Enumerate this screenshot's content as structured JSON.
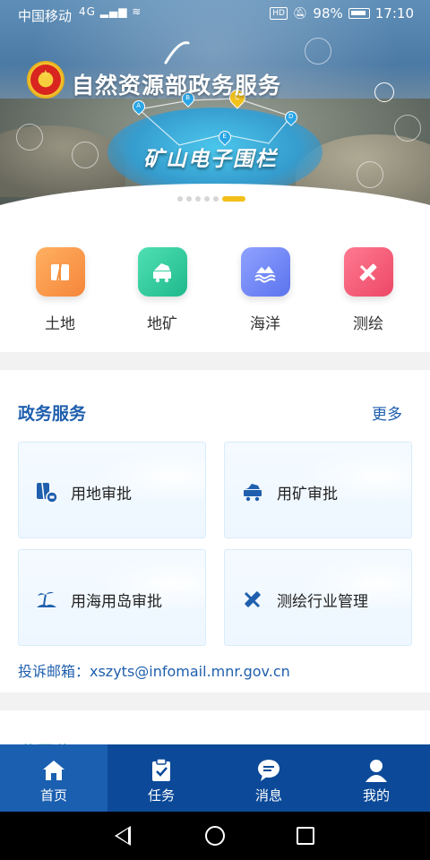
{
  "status_bar": {
    "carrier": "中国移动",
    "network": "4G",
    "hd": "HD",
    "battery": "98%",
    "time": "17:10"
  },
  "banner": {
    "title": "自然资源部政务服务",
    "subtitle": "矿山电子围栏",
    "pins": [
      "A",
      "B",
      "C",
      "D",
      "E"
    ],
    "carousel_total": 6,
    "carousel_active": 6
  },
  "categories": [
    {
      "label": "土地",
      "icon": "land-icon",
      "color": "#f5993d"
    },
    {
      "label": "地矿",
      "icon": "mining-cart-icon",
      "color": "#2dc79a"
    },
    {
      "label": "海洋",
      "icon": "ocean-wave-icon",
      "color": "#6f86f2"
    },
    {
      "label": "测绘",
      "icon": "surveying-ruler-icon",
      "color": "#f25573"
    }
  ],
  "services": {
    "title": "政务服务",
    "more": "更多",
    "cards": [
      {
        "label": "用地审批",
        "icon": "land-approval-icon"
      },
      {
        "label": "用矿审批",
        "icon": "mine-approval-icon"
      },
      {
        "label": "用海用岛审批",
        "icon": "island-approval-icon"
      },
      {
        "label": "测绘行业管理",
        "icon": "surveying-management-icon"
      }
    ],
    "email": "投诉邮箱：xszyts@infomail.mnr.gov.cn"
  },
  "public_section": {
    "title": "公开公示",
    "more": "更多"
  },
  "tabbar": [
    {
      "label": "首页",
      "icon": "home-icon",
      "active": true
    },
    {
      "label": "任务",
      "icon": "task-clipboard-icon",
      "active": false
    },
    {
      "label": "消息",
      "icon": "message-bubble-icon",
      "active": false
    },
    {
      "label": "我的",
      "icon": "user-profile-icon",
      "active": false
    }
  ],
  "colors": {
    "primary": "#1f5fae",
    "tabbar": "#0c4a99",
    "tabbar_active": "#1a5fb0",
    "carousel_active": "#f2bf1a"
  }
}
